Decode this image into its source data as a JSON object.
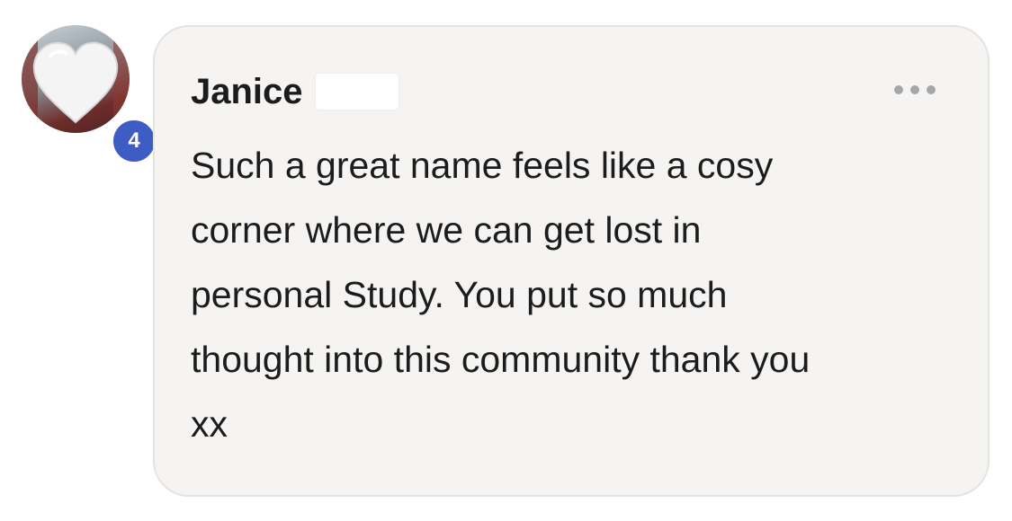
{
  "avatar": {
    "badge_count": "4",
    "badge_color": "#3d5cc4"
  },
  "comment": {
    "author": "Janice",
    "text": "Such a great name feels like a cosy\ncorner where we can get lost in\npersonal Study. You put so much\nthought into this community thank you\nxx",
    "more_icon": "more-horizontal-icon"
  },
  "colors": {
    "bubble_background": "#f5f4f2",
    "text": "#1c1c1c",
    "dots": "#a7a7a7"
  }
}
